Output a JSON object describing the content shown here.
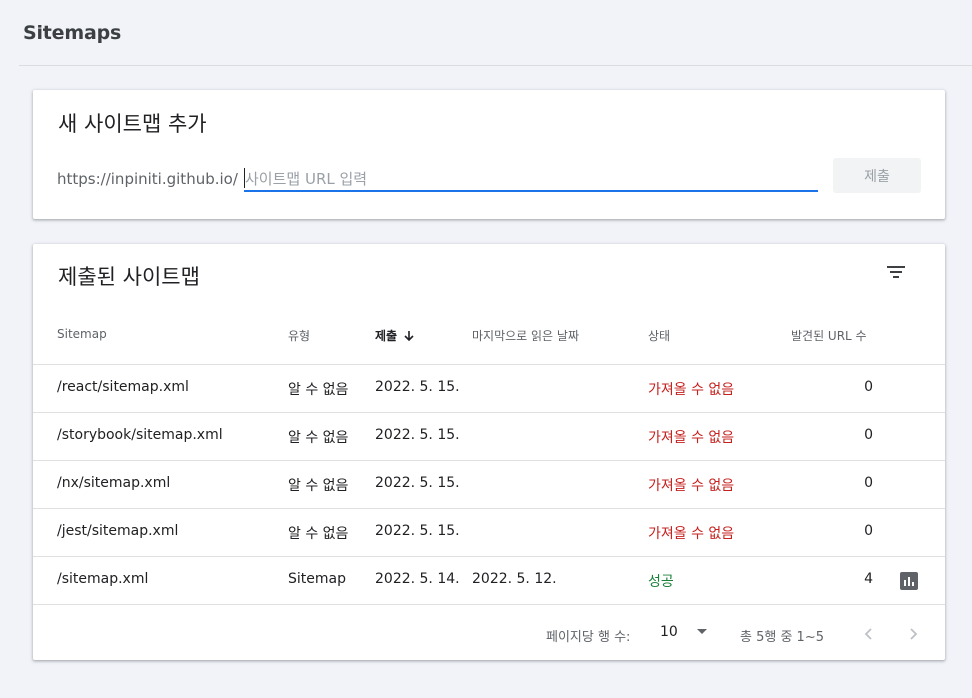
{
  "header": {
    "title": "Sitemaps"
  },
  "add_card": {
    "title": "새 사이트맵 추가",
    "url_prefix": "https://inpiniti.github.io/",
    "input_value": "",
    "input_placeholder": "사이트맵 URL 입력",
    "submit_label": "제출"
  },
  "list_card": {
    "title": "제출된 사이트맵",
    "filter_icon": "filter-list-icon",
    "columns": [
      "Sitemap",
      "유형",
      "제출",
      "마지막으로 읽은 날짜",
      "상태",
      "발견된 URL 수"
    ],
    "sorted_column": "제출",
    "rows": [
      {
        "sitemap": "/react/sitemap.xml",
        "type": "알 수 없음",
        "submitted": "2022. 5. 15.",
        "last_read": "",
        "status": "가져올 수 없음",
        "urls": "0"
      },
      {
        "sitemap": "/storybook/sitemap.xml",
        "type": "알 수 없음",
        "submitted": "2022. 5. 15.",
        "last_read": "",
        "status": "가져올 수 없음",
        "urls": "0"
      },
      {
        "sitemap": "/nx/sitemap.xml",
        "type": "알 수 없음",
        "submitted": "2022. 5. 15.",
        "last_read": "",
        "status": "가져올 수 없음",
        "urls": "0"
      },
      {
        "sitemap": "/jest/sitemap.xml",
        "type": "알 수 없음",
        "submitted": "2022. 5. 15.",
        "last_read": "",
        "status": "가져올 수 없음",
        "urls": "0"
      },
      {
        "sitemap": "/sitemap.xml",
        "type": "Sitemap",
        "submitted": "2022. 5. 14.",
        "last_read": "2022. 5. 12.",
        "status": "성공",
        "urls": "4"
      }
    ],
    "footer": {
      "rows_per_page_label": "페이지당 행 수:",
      "rows_per_page_value": "10",
      "range_text": "총 5행 중 1~5"
    }
  },
  "colors": {
    "error": "#c5221f",
    "success": "#188038",
    "accent": "#1a73e8"
  }
}
